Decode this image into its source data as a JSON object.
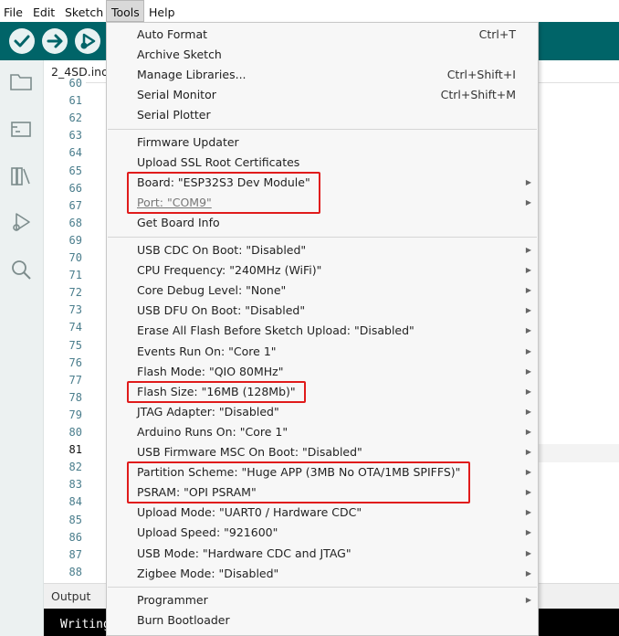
{
  "menubar": {
    "items": [
      "File",
      "Edit",
      "Sketch",
      "Tools",
      "Help"
    ]
  },
  "toolbar": {
    "color": "#006468",
    "buttons": [
      {
        "name": "verify-button",
        "icon": "checkmark-icon"
      },
      {
        "name": "upload-button",
        "icon": "arrow-right-icon"
      },
      {
        "name": "debug-button",
        "icon": "debug-icon"
      }
    ]
  },
  "editor": {
    "file_tab": "2_4SD.ino",
    "line_numbers": [
      "60",
      "61",
      "62",
      "63",
      "64",
      "65",
      "66",
      "67",
      "68",
      "69",
      "70",
      "71",
      "72",
      "73",
      "74",
      "75",
      "76",
      "77",
      "78",
      "79",
      "80",
      "81",
      "82",
      "83",
      "84",
      "85",
      "86",
      "87",
      "88"
    ],
    "current_line": "81"
  },
  "sidebar": {
    "icons": [
      "folder-icon",
      "boards-manager-icon",
      "library-manager-icon",
      "debug-icon",
      "search-icon"
    ]
  },
  "output": {
    "label": "Output",
    "console_text": "Writing"
  },
  "tools_menu": {
    "groups": [
      [
        {
          "label": "Auto Format",
          "shortcut": "Ctrl+T"
        },
        {
          "label": "Archive Sketch"
        },
        {
          "label": "Manage Libraries...",
          "shortcut": "Ctrl+Shift+I"
        },
        {
          "label": "Serial Monitor",
          "shortcut": "Ctrl+Shift+M"
        },
        {
          "label": "Serial Plotter"
        }
      ],
      [
        {
          "label": "Firmware Updater"
        },
        {
          "label": "Upload SSL Root Certificates"
        },
        {
          "label": "Board: \"ESP32S3 Dev Module\"",
          "submenu": true,
          "highlight": true
        },
        {
          "label": "Port: \"COM9\"",
          "submenu": true,
          "disabled": true,
          "highlight": true
        },
        {
          "label": "Get Board Info"
        }
      ],
      [
        {
          "label": "USB CDC On Boot: \"Disabled\"",
          "submenu": true
        },
        {
          "label": "CPU Frequency: \"240MHz (WiFi)\"",
          "submenu": true
        },
        {
          "label": "Core Debug Level: \"None\"",
          "submenu": true
        },
        {
          "label": "USB DFU On Boot: \"Disabled\"",
          "submenu": true
        },
        {
          "label": "Erase All Flash Before Sketch Upload: \"Disabled\"",
          "submenu": true
        },
        {
          "label": "Events Run On: \"Core 1\"",
          "submenu": true
        },
        {
          "label": "Flash Mode: \"QIO 80MHz\"",
          "submenu": true
        },
        {
          "label": "Flash Size: \"16MB (128Mb)\"",
          "submenu": true,
          "highlight": true
        },
        {
          "label": "JTAG Adapter: \"Disabled\"",
          "submenu": true
        },
        {
          "label": "Arduino Runs On: \"Core 1\"",
          "submenu": true
        },
        {
          "label": "USB Firmware MSC On Boot: \"Disabled\"",
          "submenu": true
        },
        {
          "label": "Partition Scheme: \"Huge APP (3MB No OTA/1MB SPIFFS)\"",
          "submenu": true,
          "highlight": true
        },
        {
          "label": "PSRAM: \"OPI PSRAM\"",
          "submenu": true,
          "highlight": true
        },
        {
          "label": "Upload Mode: \"UART0 / Hardware CDC\"",
          "submenu": true
        },
        {
          "label": "Upload Speed: \"921600\"",
          "submenu": true
        },
        {
          "label": "USB Mode: \"Hardware CDC and JTAG\"",
          "submenu": true
        },
        {
          "label": "Zigbee Mode: \"Disabled\"",
          "submenu": true
        }
      ],
      [
        {
          "label": "Programmer",
          "submenu": true
        },
        {
          "label": "Burn Bootloader"
        }
      ]
    ],
    "highlight_color": "#e01b1b"
  }
}
